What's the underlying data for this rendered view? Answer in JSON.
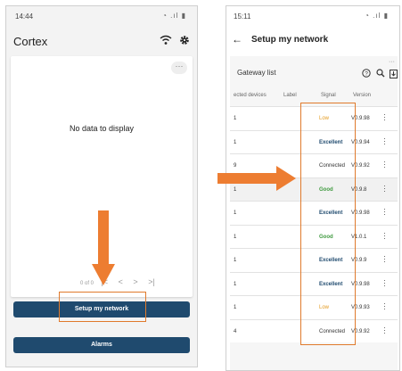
{
  "left": {
    "status_time": "14:44",
    "app_title": "Cortex",
    "no_data_text": "No data to display",
    "pager_range": "0 of 0",
    "setup_button": "Setup my network",
    "alarms_button": "Alarms"
  },
  "right": {
    "status_time": "15:11",
    "page_title": "Setup my network",
    "gateway_title": "Gateway list",
    "columns": {
      "devices": "ected devices",
      "label": "Label",
      "signal": "Signal",
      "version": "Version"
    },
    "rows": [
      {
        "devices": "1",
        "signal": "Low",
        "version": "V0.9.98"
      },
      {
        "devices": "1",
        "signal": "Excellent",
        "version": "V0.9.94"
      },
      {
        "devices": "9",
        "signal": "Connected",
        "version": "V0.9.92"
      },
      {
        "devices": "1",
        "signal": "Good",
        "version": "V0.9.8"
      },
      {
        "devices": "1",
        "signal": "Excellent",
        "version": "V0.9.98"
      },
      {
        "devices": "1",
        "signal": "Good",
        "version": "V1.0.1"
      },
      {
        "devices": "1",
        "signal": "Excellent",
        "version": "V0.9.9"
      },
      {
        "devices": "1",
        "signal": "Excellent",
        "version": "V0.9.98"
      },
      {
        "devices": "1",
        "signal": "Low",
        "version": "V0.9.93"
      },
      {
        "devices": "4",
        "signal": "Connected",
        "version": "V0.9.92"
      }
    ]
  },
  "colors": {
    "primary": "#1f4a6e",
    "annotation": "#ed7d31",
    "signal_low": "#e49a1e",
    "signal_good": "#3f9a3f"
  }
}
